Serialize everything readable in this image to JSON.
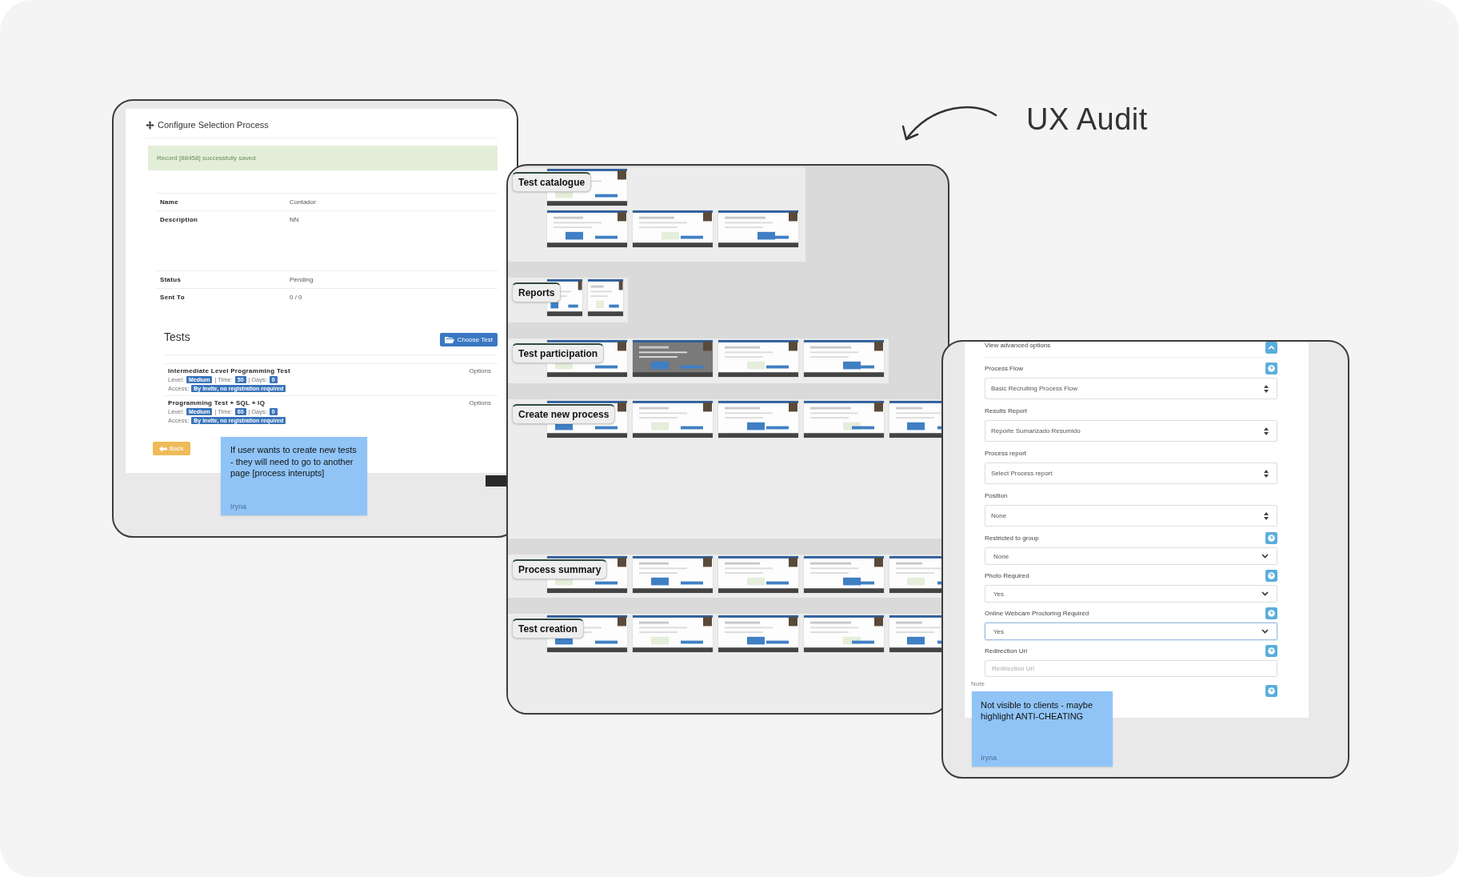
{
  "heading": {
    "title": "UX Audit"
  },
  "configure_panel": {
    "title": "Configure Selection Process",
    "alert": "Record [88458] successfully saved",
    "details": [
      {
        "label": "Name",
        "value": "Contador"
      },
      {
        "label": "Description",
        "value": "NN"
      },
      {
        "label": "Status",
        "value": "Pending"
      },
      {
        "label": "Sent To",
        "value": "0 /  0"
      }
    ],
    "tests_heading": "Tests",
    "choose_button": "Choose Test",
    "tests": [
      {
        "name": "Intermediate Level Programming Test",
        "options": "Options",
        "level_label": "Level:",
        "level": "Medium",
        "time_label": "| Time:",
        "time": "50",
        "days_label": "| Days:",
        "days": "0",
        "access_label": "Access:",
        "access": "By invite, no registration required"
      },
      {
        "name": "Programming Test + SQL + IQ",
        "options": "Options",
        "level_label": "Level:",
        "level": "Medium",
        "time_label": "| Time:",
        "time": "60",
        "days_label": "| Days:",
        "days": "0",
        "access_label": "Access:",
        "access": "By invite, no registration required"
      }
    ],
    "back_button": "Back",
    "note": {
      "text": "If user wants to create new tests - they will need to go to another page [process interupts]",
      "author": "Iryna"
    }
  },
  "flow_board": {
    "sections": [
      {
        "title": "Test catalogue"
      },
      {
        "title": "Reports"
      },
      {
        "title": "Test participation"
      },
      {
        "title": "Create new process"
      },
      {
        "title": "Process summary"
      },
      {
        "title": "Test creation"
      }
    ]
  },
  "settings_panel": {
    "advanced_toggle": "View advanced options",
    "fields": [
      {
        "label": "Process Flow",
        "help": true,
        "kind": "select",
        "value": "Basic Recruiting Process Flow",
        "focused": false
      },
      {
        "label": "Results Report",
        "help": false,
        "kind": "select",
        "value": "Reporte Sumarizado Resumido",
        "focused": false
      },
      {
        "label": "Process report",
        "help": false,
        "kind": "select",
        "value": "Select Process report",
        "focused": false
      },
      {
        "label": "Position",
        "help": false,
        "kind": "select",
        "value": "None",
        "focused": false
      },
      {
        "label": "Restricted to group",
        "help": true,
        "kind": "dropdown",
        "value": "None",
        "focused": false
      },
      {
        "label": "Photo Required",
        "help": true,
        "kind": "dropdown",
        "value": "Yes",
        "focused": false
      },
      {
        "label": "Online Webcam Proctoring Required",
        "help": true,
        "kind": "dropdown",
        "value": "Yes",
        "focused": true
      },
      {
        "label": "Redirection Url",
        "help": true,
        "kind": "input",
        "placeholder": "Redirection Url",
        "focused": false
      }
    ],
    "note_label": "Note",
    "note": {
      "text": "Not visible to clients - maybe highlight ANTI-CHEATING",
      "author": "Iryna"
    }
  }
}
